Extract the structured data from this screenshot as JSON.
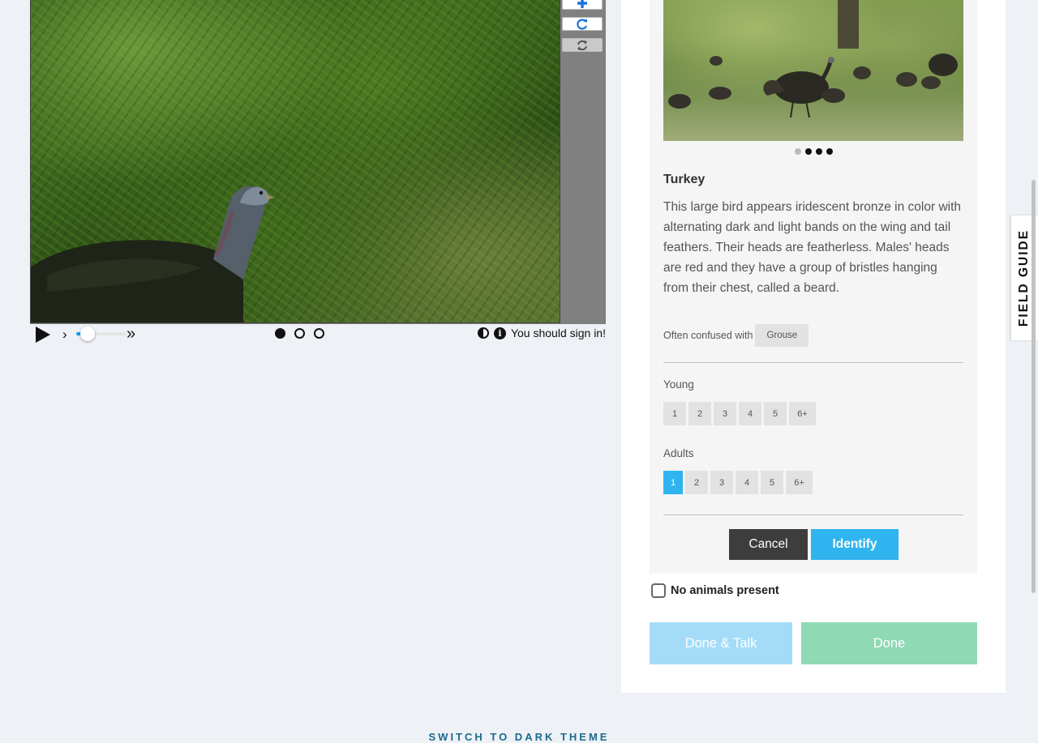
{
  "viewer": {
    "toolbar": {
      "zoom_in_icon": "plus-icon",
      "rotate_icon": "rotate-icon",
      "reset_icon": "reset-icon"
    },
    "controls": {
      "play_icon": "play-icon",
      "step_icon": "step-forward-icon",
      "speed_slider_fraction": 0.1,
      "fast_forward_icon": "fast-forward-icon",
      "frames": [
        {
          "active": true
        },
        {
          "active": false
        },
        {
          "active": false
        }
      ],
      "signin_message": "You should sign in!"
    }
  },
  "species": {
    "images_count": 4,
    "active_image": 0,
    "name": "Turkey",
    "description": "This large bird appears iridescent bronze in color with alternating dark and light bands on the wing and tail feathers. Their heads are featherless. Males' heads are red and they have a group of bristles hanging from their chest, called a beard.",
    "confused_label": "Often confused with",
    "confused_with": [
      "Grouse"
    ]
  },
  "questions": [
    {
      "label": "Young",
      "options": [
        "1",
        "2",
        "3",
        "4",
        "5",
        "6+"
      ],
      "selected": null
    },
    {
      "label": "Adults",
      "options": [
        "1",
        "2",
        "3",
        "4",
        "5",
        "6+"
      ],
      "selected": "1"
    }
  ],
  "actions": {
    "cancel": "Cancel",
    "identify": "Identify",
    "no_animals": "No animals present",
    "done_talk": "Done & Talk",
    "done": "Done"
  },
  "field_guide_label": "FIELD GUIDE",
  "footer_link": "SWITCH TO DARK THEME",
  "colors": {
    "accent": "#2fb4ef",
    "done_talk": "#a4dcf8",
    "done": "#8fd9b5",
    "cancel": "#3d3d3d",
    "background": "#eef1f5"
  }
}
